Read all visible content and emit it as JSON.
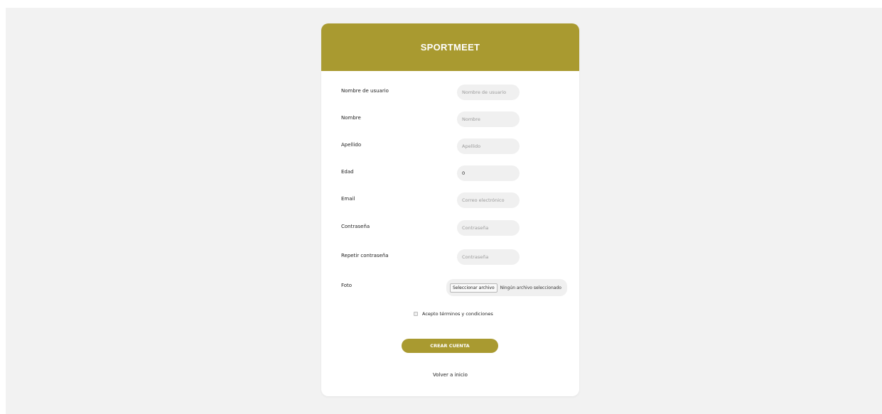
{
  "brand": "SPORTMEET",
  "form": {
    "fields": [
      {
        "label": "Nombre de usuario",
        "placeholder": "Nombre de usuario",
        "value": ""
      },
      {
        "label": "Nombre",
        "placeholder": "Nombre",
        "value": ""
      },
      {
        "label": "Apellido",
        "placeholder": "Apellido",
        "value": ""
      },
      {
        "label": "Edad",
        "placeholder": "",
        "value": "0"
      },
      {
        "label": "Email",
        "placeholder": "Correo electrónico",
        "value": ""
      },
      {
        "label": "Contraseña",
        "placeholder": "Contraseña",
        "value": ""
      },
      {
        "label": "Repetir contraseña",
        "placeholder": "Contraseña",
        "value": ""
      }
    ],
    "photo": {
      "label": "Foto",
      "button_label": "Seleccionar archivo",
      "status": "Ningún archivo seleccionado"
    },
    "terms_label": "Acepto términos y condiciones",
    "submit_label": "CREAR CUENTA",
    "back_link": "Volver a inicio"
  },
  "colors": {
    "accent": "#a99a30",
    "page_background": "#f2f2f2",
    "input_background": "#f0f0f0"
  }
}
